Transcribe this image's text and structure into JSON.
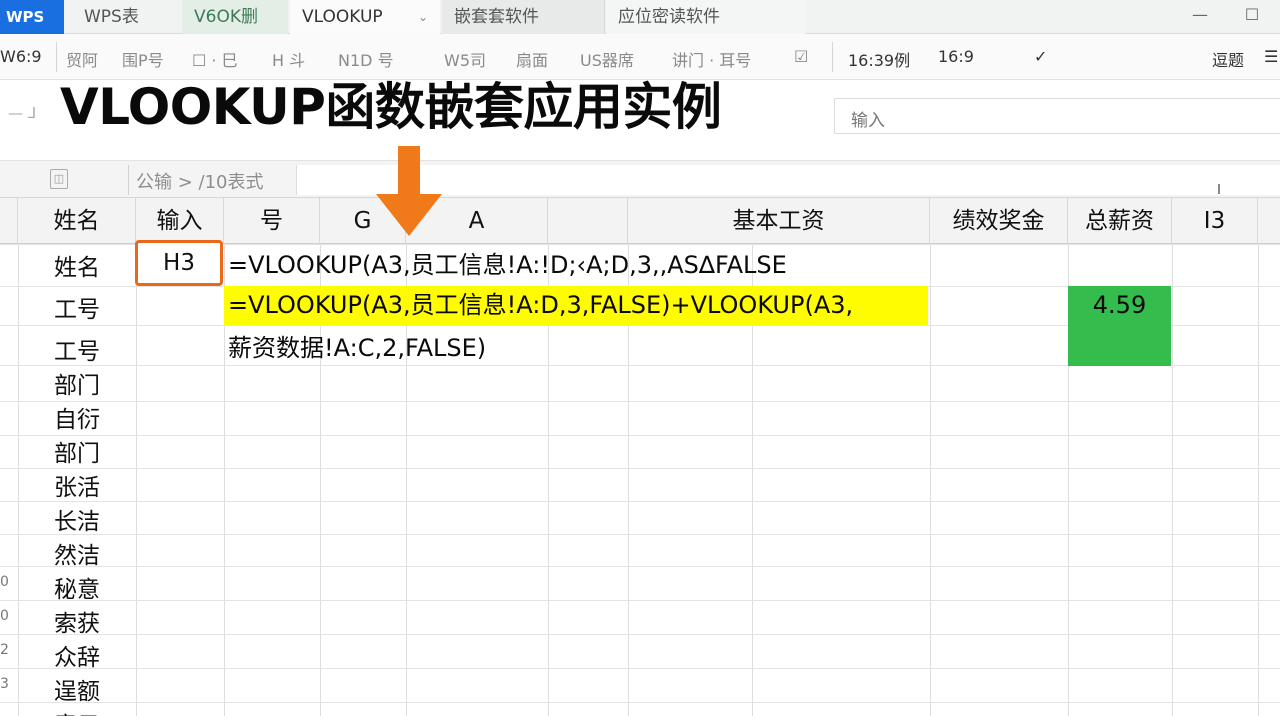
{
  "tabs": {
    "logo": "WPS",
    "tab1": "WPS表",
    "tab2": "V6OK删",
    "tab3": "VLOOKUP",
    "tab3_caret": "⌄",
    "tab4": "嵌套套软件",
    "tab5": "应位密读软件"
  },
  "window": {
    "minimize_icon": "minimize-icon",
    "maximize_icon": "maximize-icon",
    "minimize": "—",
    "maximize": "☐"
  },
  "ribbon": {
    "version": "W6:9",
    "items": [
      "贸阿",
      "围P号",
      "☐ · 巳",
      "H 斗",
      "N1D 号",
      "W5司",
      "扇面",
      "US器席",
      "讲门 · 耳号",
      "☑",
      "16:39例",
      "16:9",
      "✓",
      "逗题",
      "☰"
    ]
  },
  "title": "VLOOKUP函数嵌套应用实例",
  "left_hint": "— ⅃",
  "top_input": {
    "placeholder": "输入"
  },
  "formula_bar": {
    "icon": "◫",
    "path": "公输 > /10表式"
  },
  "columns": [
    "姓名",
    "输入",
    "号",
    "G",
    "A",
    "基本工资",
    "绩效奖金",
    "总薪资",
    "I3"
  ],
  "row_labels": [
    "姓名",
    "工号",
    "工号",
    "部门",
    "自衍",
    "部门",
    "张活",
    "长洁",
    "然洁",
    "秘意",
    "索获",
    "众辞",
    "逞额",
    "意云"
  ],
  "row_numbers": [
    "",
    "",
    "",
    "",
    "",
    "",
    "",
    "",
    "",
    "0",
    "0",
    "2",
    "3",
    ""
  ],
  "selected_cell": "H3",
  "formula_line_1": "=VLOOKUP(A3,员工信息!A:!D;‹A;D,3,,AS∆FALSE",
  "formula_line_2": "=VLOOKUP(A3,员工信息!A:D,3,FALSE)+VLOOKUP(A3,",
  "formula_line_3": "薪资数据!A:C,2,FALSE)",
  "total_value": "4.59",
  "colors": {
    "highlight": "#fffb00",
    "total_fill": "#34bd4c",
    "arrow": "#f07a1a",
    "cell_border": "#e8691a",
    "logo_bg": "#1a6fe0"
  }
}
